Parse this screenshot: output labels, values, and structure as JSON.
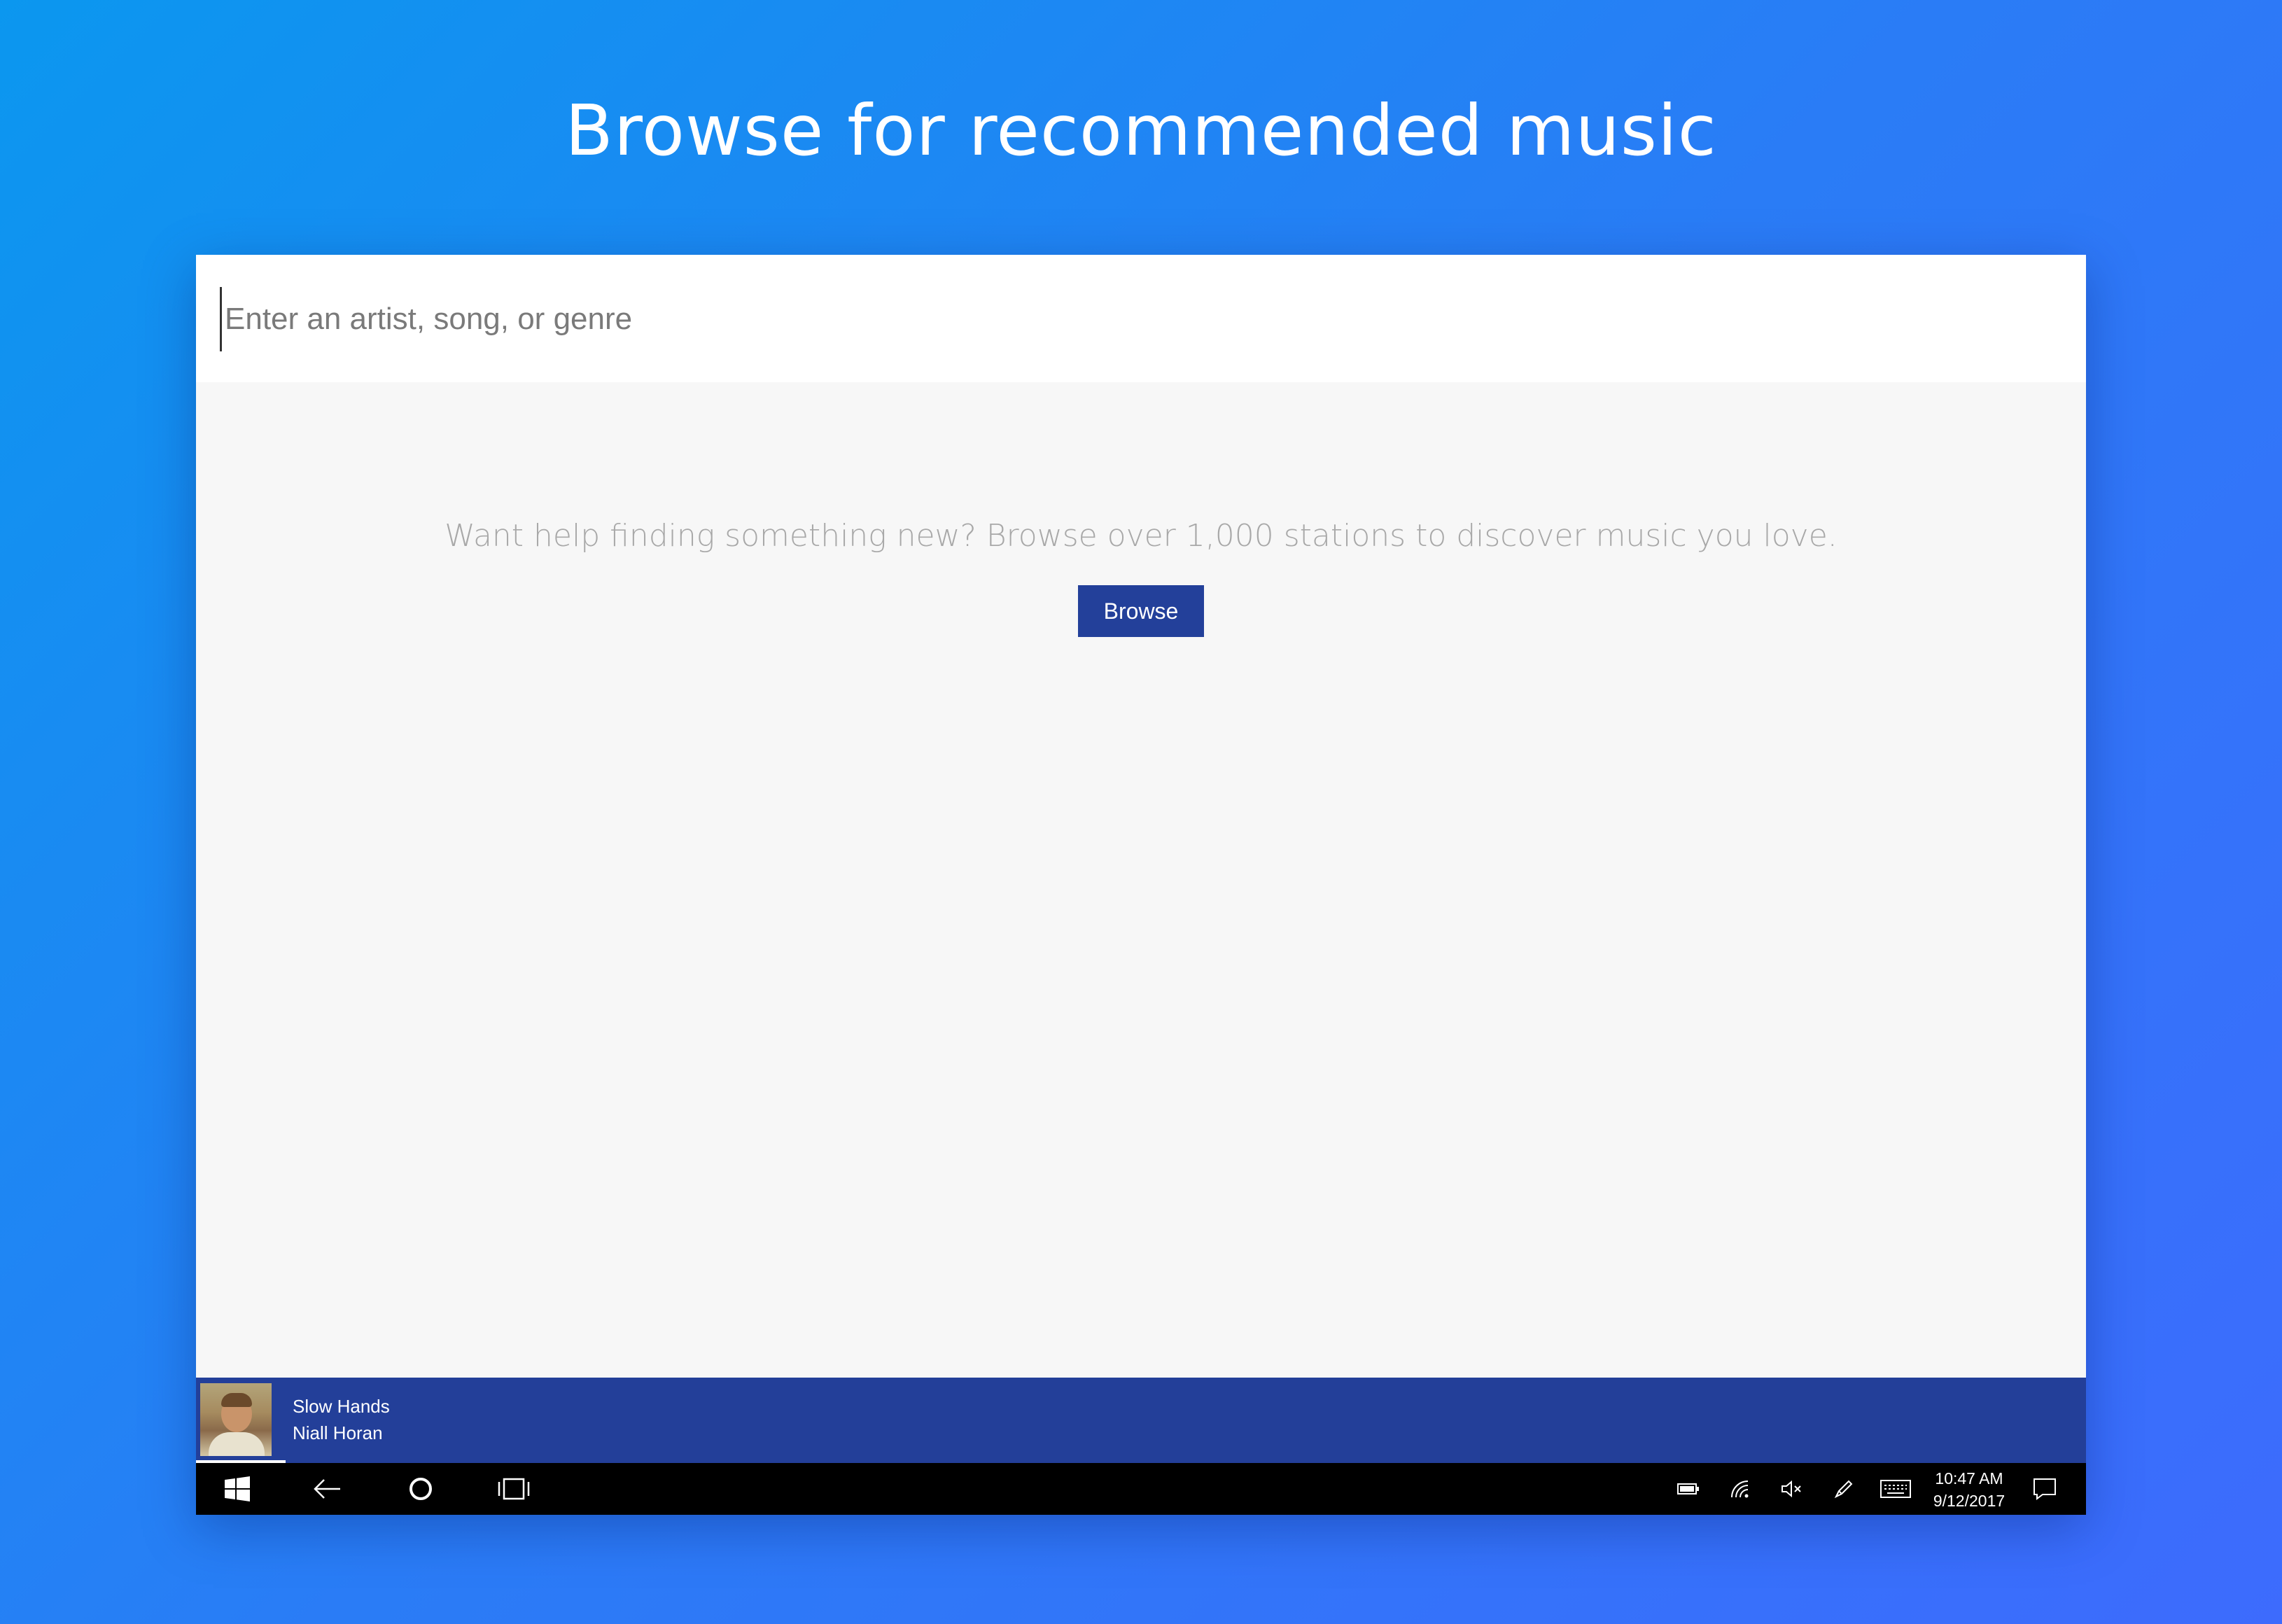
{
  "headline": "Browse for recommended music",
  "search": {
    "placeholder": "Enter an artist, song, or genre"
  },
  "browse_section": {
    "prompt": "Want help finding something new? Browse over 1,000 stations to discover music you love.",
    "button_label": "Browse"
  },
  "now_playing": {
    "title": "Slow Hands",
    "artist": "Niall Horan",
    "album_art_icon": "album-art"
  },
  "taskbar": {
    "time": "10:47 AM",
    "date": "9/12/2017",
    "icons": [
      "windows-start-icon",
      "back-arrow-icon",
      "cortana-circle-icon",
      "task-view-icon",
      "battery-icon",
      "wifi-icon",
      "volume-muted-icon",
      "pen-icon",
      "keyboard-icon",
      "action-center-icon"
    ]
  },
  "colors": {
    "accent": "#233f99",
    "background_gradient_start": "#0b97ef",
    "background_gradient_end": "#3d6bfd"
  }
}
